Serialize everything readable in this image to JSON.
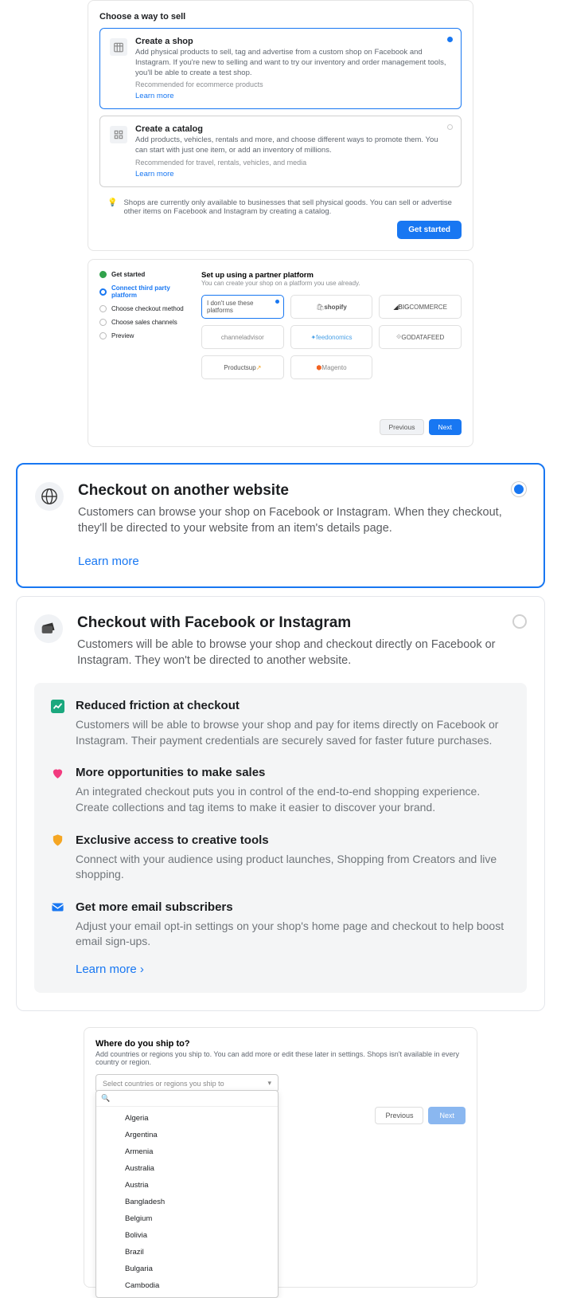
{
  "sell": {
    "heading": "Choose a way to sell",
    "shop": {
      "title": "Create a shop",
      "desc": "Add physical products to sell, tag and advertise from a custom shop on Facebook and Instagram. If you're new to selling and want to try our inventory and order management tools, you'll be able to create a test shop.",
      "rec": "Recommended for ecommerce products",
      "learn": "Learn more"
    },
    "catalog": {
      "title": "Create a catalog",
      "desc": "Add products, vehicles, rentals and more, and choose different ways to promote them. You can start with just one item, or add an inventory of millions.",
      "rec": "Recommended for travel, rentals, vehicles, and media",
      "learn": "Learn more"
    },
    "note": "Shops are currently only available to businesses that sell physical goods. You can sell or advertise other items on Facebook and Instagram by creating a catalog.",
    "cta": "Get started"
  },
  "steps": {
    "s1": "Get started",
    "s2": "Connect third party platform",
    "s3": "Choose checkout method",
    "s4": "Choose sales channels",
    "s5": "Preview"
  },
  "platform": {
    "title": "Set up using a partner platform",
    "sub": "You can create your shop on a platform you use already.",
    "opt_none": "I don't use these platforms",
    "opt_shopify": "shopify",
    "opt_bigcommerce": "COMMERCE",
    "opt_channeladvisor": "channeladvisor",
    "opt_feedonomics": "feedonomics",
    "opt_godatafeed": "GODATAFEED",
    "opt_productsup": "Productsup",
    "opt_magento": "Magento",
    "prev": "Previous",
    "next": "Next"
  },
  "checkout_web": {
    "title": "Checkout on another website",
    "desc": "Customers can browse your shop on Facebook or Instagram. When they checkout, they'll be directed to your website from an item's details page.",
    "learn": "Learn more"
  },
  "checkout_fb": {
    "title": "Checkout with Facebook or Instagram",
    "desc": "Customers will be able to browse your shop and checkout directly on Facebook or Instagram. They won't be directed to another website.",
    "feat1_title": "Reduced friction at checkout",
    "feat1_desc": "Customers will be able to browse your shop and pay for items directly on Facebook or Instagram. Their payment credentials are securely saved for faster future purchases.",
    "feat2_title": "More opportunities to make sales",
    "feat2_desc": "An integrated checkout puts you in control of the end-to-end shopping experience. Create collections and tag items to make it easier to discover your brand.",
    "feat3_title": "Exclusive access to creative tools",
    "feat3_desc": "Connect with your audience using product launches, Shopping from Creators and live shopping.",
    "feat4_title": "Get more email subscribers",
    "feat4_desc": "Adjust your email opt-in settings on your shop's home page and checkout to help boost email sign-ups.",
    "learn": "Learn more"
  },
  "ship": {
    "title": "Where do you ship to?",
    "sub": "Add countries or regions you ship to. You can add more or edit these later in settings. Shops isn't available in every country or region.",
    "placeholder": "Select countries or regions you ship to",
    "countries": [
      "Algeria",
      "Argentina",
      "Armenia",
      "Australia",
      "Austria",
      "Bangladesh",
      "Belgium",
      "Bolivia",
      "Brazil",
      "Bulgaria",
      "Cambodia"
    ],
    "prev": "Previous",
    "next": "Next"
  }
}
